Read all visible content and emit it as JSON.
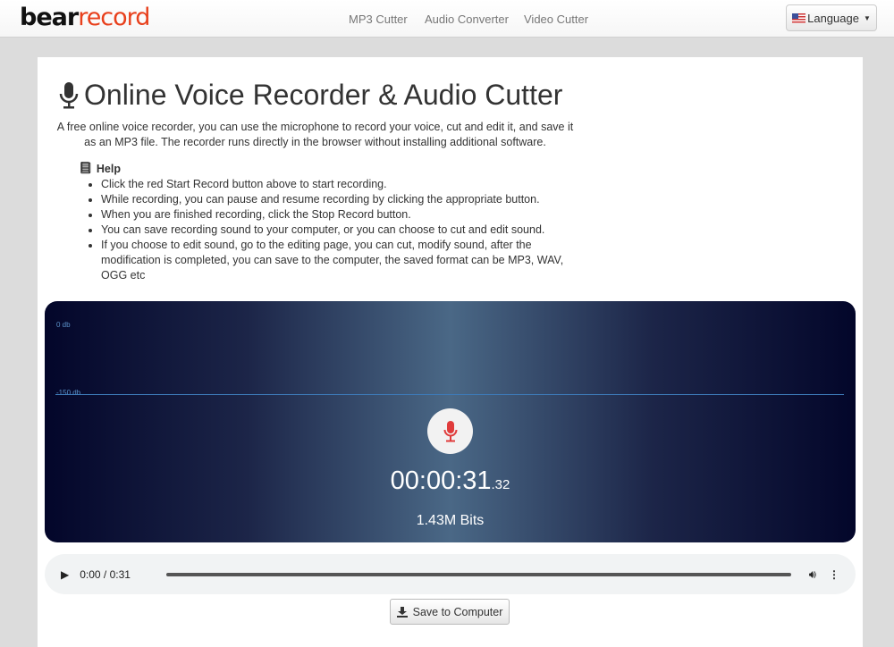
{
  "header": {
    "logo_part1": "bear",
    "logo_part2": "record",
    "nav": [
      "MP3 Cutter",
      "Audio Converter",
      "Video Cutter"
    ],
    "language": "Language"
  },
  "main": {
    "title": "Online Voice Recorder & Audio Cutter",
    "description": "A free online voice recorder, you can use the microphone to record your voice, cut and edit it, and save it as an MP3 file. The recorder runs directly in the browser without installing additional software.",
    "help_title": "Help",
    "help_items": [
      "Click the red Start Record button above to start recording.",
      "While recording, you can pause and resume recording by clicking the appropriate button.",
      "When you are finished recording, click the Stop Record button.",
      "You can save recording sound to your computer, or you can choose to cut and edit sound.",
      "If you choose to edit sound, go to the editing page, you can cut, modify sound, after the modification is completed, you can save to the computer, the saved format can be MP3, WAV, OGG etc"
    ]
  },
  "recorder": {
    "db_top": "0 db",
    "db_bottom": "-150 db",
    "timer": "00:00:31",
    "timer_ms": ".32",
    "bits": "1.43M Bits",
    "mic_color": "#e03c3c"
  },
  "player": {
    "time": "0:00 / 0:31"
  },
  "save_label": "Save to Computer"
}
